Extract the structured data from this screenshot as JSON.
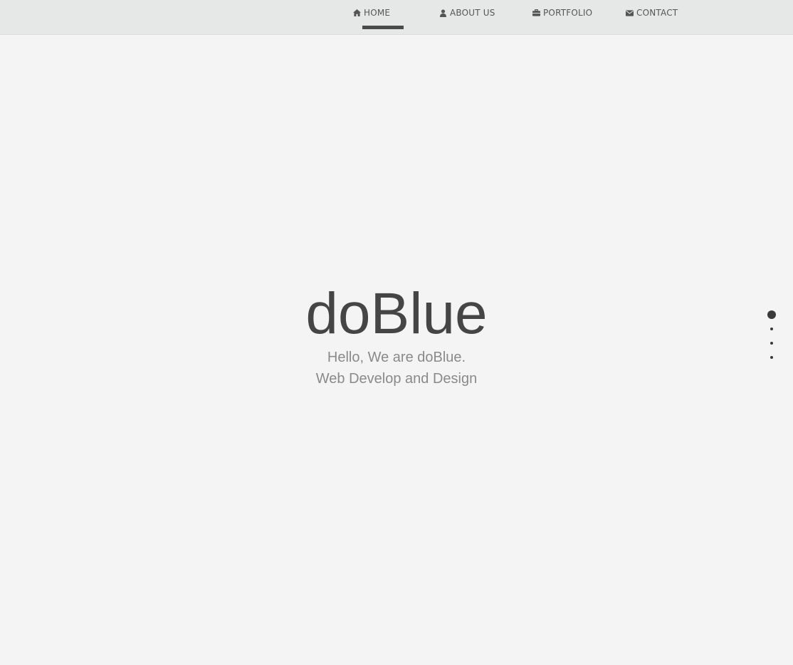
{
  "nav": {
    "items": [
      {
        "label": "HOME",
        "icon": "home-icon",
        "active": true
      },
      {
        "label": "ABOUT US",
        "icon": "user-icon",
        "active": false
      },
      {
        "label": "PORTFOLIO",
        "icon": "briefcase-icon",
        "active": false
      },
      {
        "label": "CONTACT",
        "icon": "envelope-icon",
        "active": false
      }
    ]
  },
  "hero": {
    "title": "doBlue",
    "line1": "Hello, We are doBlue.",
    "line2": "Web Develop and Design"
  },
  "pagination": {
    "count": 4,
    "active_index": 0
  },
  "colors": {
    "background": "#f4f4f4",
    "navbar": "#e6e8e7",
    "text_dark": "#454545",
    "text_muted": "#8a8a8a",
    "accent": "#4a4a4a"
  }
}
